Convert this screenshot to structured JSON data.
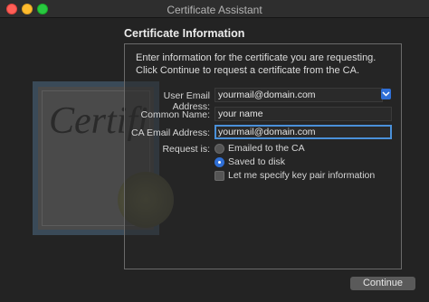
{
  "window": {
    "title": "Certificate Assistant"
  },
  "heading": "Certificate Information",
  "intro": "Enter information for the certificate you are requesting. Click Continue to request a certificate from the CA.",
  "illustration": {
    "text": "Certifi"
  },
  "form": {
    "user_email_label": "User Email Address:",
    "user_email_value": "yourmail@domain.com",
    "common_name_label": "Common Name:",
    "common_name_value": "your name",
    "ca_email_label": "CA Email Address:",
    "ca_email_value": "yourmail@domain.com",
    "request_label": "Request is:",
    "options": [
      {
        "label": "Emailed to the CA",
        "selected": false
      },
      {
        "label": "Saved to disk",
        "selected": true
      }
    ],
    "key_pair_label": "Let me specify key pair information",
    "key_pair_checked": false
  },
  "buttons": {
    "continue": "Continue"
  },
  "colors": {
    "accent": "#2f6fd6",
    "focus_ring": "#4a90d9"
  }
}
